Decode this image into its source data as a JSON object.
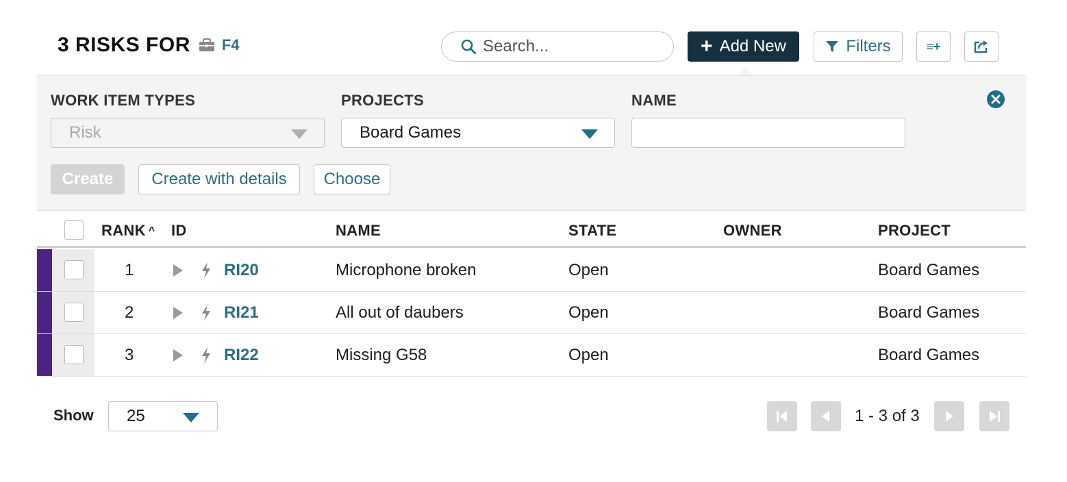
{
  "header": {
    "title": "3 RISKS FOR",
    "project_code": "F4",
    "project_icon": "briefcase-icon"
  },
  "toolbar": {
    "search_placeholder": "Search...",
    "add_new_label": "Add New",
    "filters_label": "Filters",
    "columns_label": "≡+",
    "accent_color": "#17303f",
    "link_color": "#2d6e86"
  },
  "filter_panel": {
    "work_item_types_label": "WORK ITEM TYPES",
    "work_item_types_value": "Risk",
    "projects_label": "PROJECTS",
    "projects_value": "Board Games",
    "name_label": "NAME",
    "name_value": "",
    "create_label": "Create",
    "create_with_details_label": "Create with details",
    "choose_label": "Choose"
  },
  "table": {
    "columns": {
      "rank": "RANK",
      "id": "ID",
      "name": "NAME",
      "state": "STATE",
      "owner": "OWNER",
      "project": "PROJECT"
    },
    "rows": [
      {
        "rank": "1",
        "id": "RI20",
        "name": "Microphone broken",
        "state": "Open",
        "owner": "",
        "project": "Board Games"
      },
      {
        "rank": "2",
        "id": "RI21",
        "name": "All out of daubers",
        "state": "Open",
        "owner": "",
        "project": "Board Games"
      },
      {
        "rank": "3",
        "id": "RI22",
        "name": "Missing G58",
        "state": "Open",
        "owner": "",
        "project": "Board Games"
      }
    ],
    "row_strip_color": "#4a2480"
  },
  "footer": {
    "show_label": "Show",
    "page_size": "25",
    "page_info": "1 - 3 of 3"
  }
}
